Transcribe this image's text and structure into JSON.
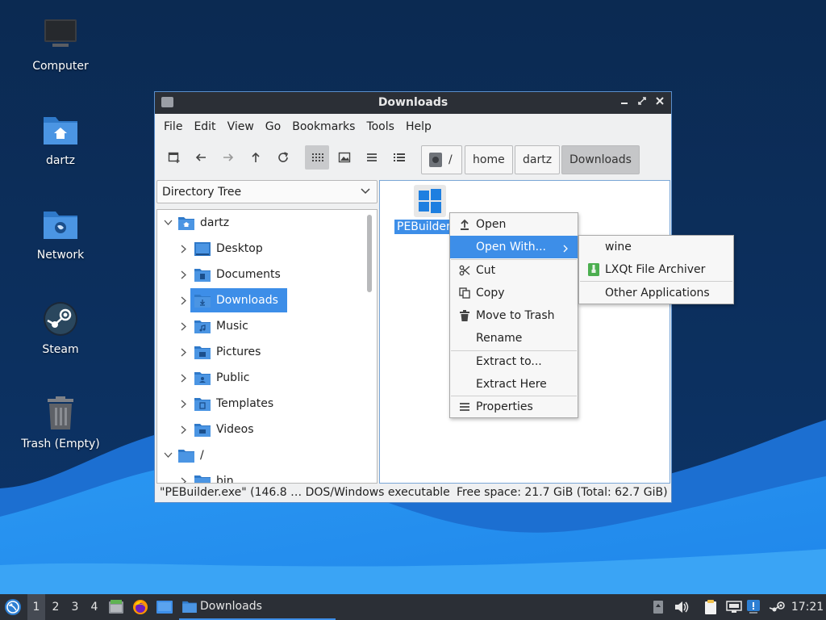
{
  "desktop": {
    "icons": [
      {
        "label": "Computer",
        "icon": "computer-icon"
      },
      {
        "label": "dartz",
        "icon": "home-folder-icon"
      },
      {
        "label": "Network",
        "icon": "network-folder-icon"
      },
      {
        "label": "Steam",
        "icon": "steam-icon"
      },
      {
        "label": "Trash (Empty)",
        "icon": "trash-icon"
      }
    ]
  },
  "window": {
    "title": "Downloads",
    "menu": [
      "File",
      "Edit",
      "View",
      "Go",
      "Bookmarks",
      "Tools",
      "Help"
    ],
    "path": [
      "/",
      "home",
      "dartz",
      "Downloads"
    ],
    "side_panel_mode": "Directory Tree",
    "tree": [
      {
        "label": "dartz"
      },
      {
        "label": "Desktop"
      },
      {
        "label": "Documents"
      },
      {
        "label": "Downloads"
      },
      {
        "label": "Music"
      },
      {
        "label": "Pictures"
      },
      {
        "label": "Public"
      },
      {
        "label": "Templates"
      },
      {
        "label": "Videos"
      },
      {
        "label": "/"
      },
      {
        "label": "bin"
      }
    ],
    "files": [
      {
        "name": "PEBuilder.exe",
        "icon": "windows-icon"
      }
    ],
    "status": {
      "selection": "\"PEBuilder.exe\" (146.8 … DOS/Windows executable",
      "free_space": "Free space: 21.7 GiB (Total: 62.7 GiB)"
    }
  },
  "context_menu": {
    "items": [
      "Open",
      "Open With...",
      "Cut",
      "Copy",
      "Move to Trash",
      "Rename",
      "Extract to...",
      "Extract Here",
      "Properties"
    ],
    "submenu": [
      "wine",
      "LXQt File Archiver",
      "Other Applications"
    ]
  },
  "taskbar": {
    "desktops": [
      "1",
      "2",
      "3",
      "4"
    ],
    "active_desktop": "1",
    "task": "Downloads",
    "clock": "17:21"
  },
  "colors": {
    "accent": "#3d8ee8",
    "titlebar": "#2b2f36",
    "wallpaper_dark": "#0c2b54",
    "wallpaper_wave": "#1f8ff0"
  }
}
